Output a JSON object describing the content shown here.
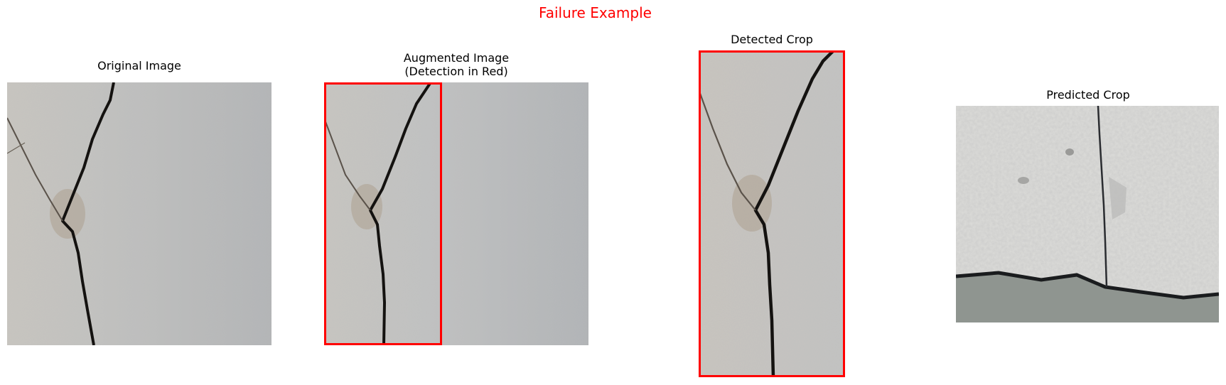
{
  "figure": {
    "suptitle": "Failure Example",
    "suptitle_color": "#ff0000",
    "detection_box_color": "#ff0000"
  },
  "panels": [
    {
      "title": "Original Image",
      "image": "concrete-wall-crack-photo"
    },
    {
      "title": "Augmented Image\n(Detection in Red)",
      "image": "concrete-wall-crack-photo-with-detection-box"
    },
    {
      "title": "Detected Crop",
      "image": "cropped-crack-region-photo"
    },
    {
      "title": "Predicted Crop",
      "image": "peeling-white-paint-crack-photo"
    }
  ]
}
